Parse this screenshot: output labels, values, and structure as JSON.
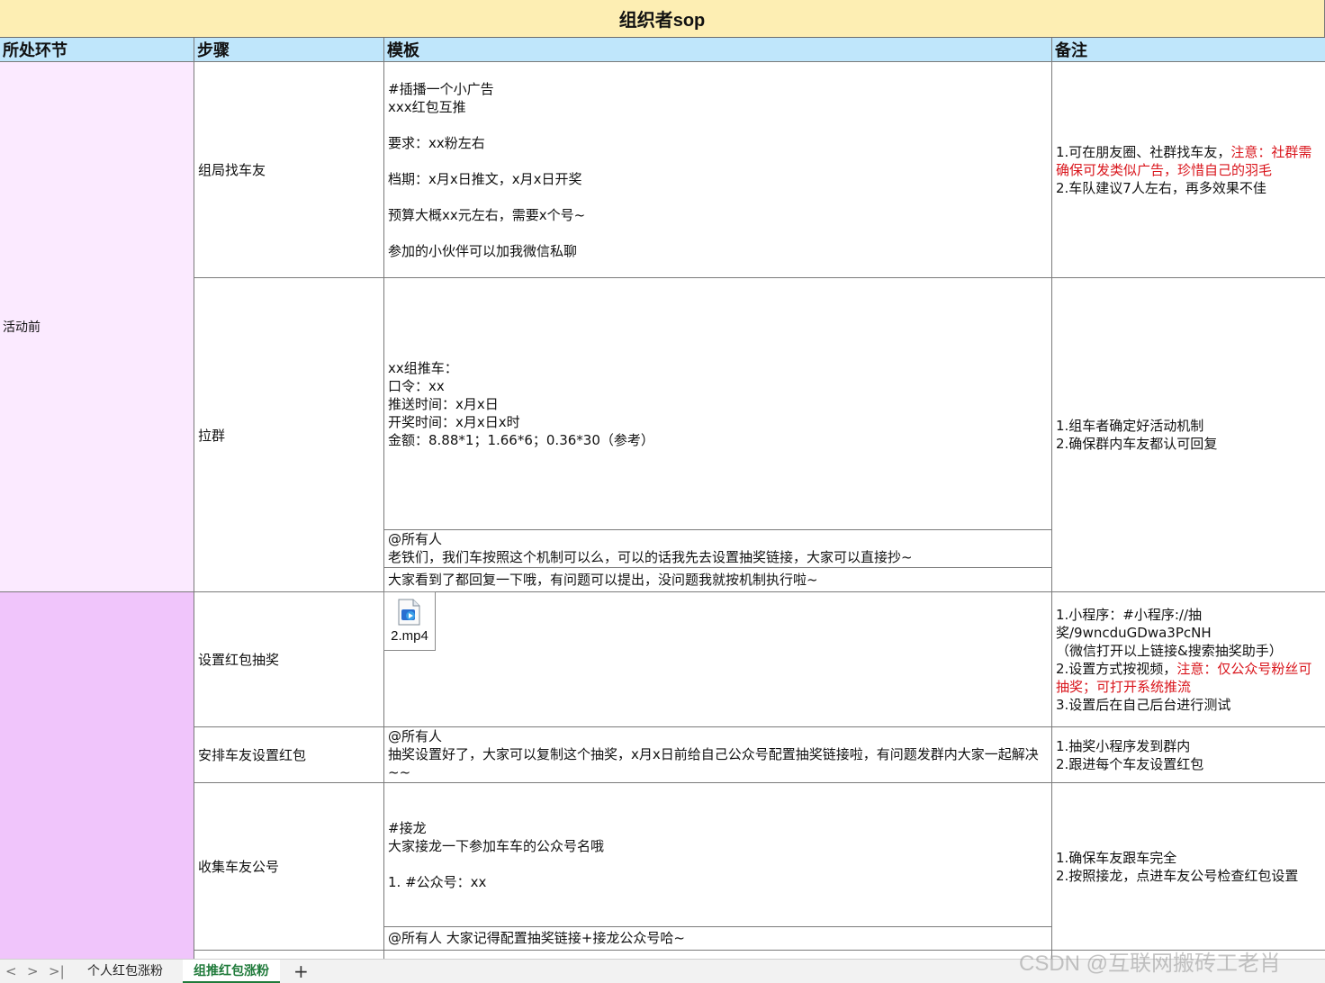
{
  "title": "组织者sop",
  "headers": {
    "stage": "所处环节",
    "step": "步骤",
    "template": "模板",
    "note": "备注"
  },
  "stages": {
    "before": "活动前",
    "during": ""
  },
  "rows": [
    {
      "step": "组局找车友",
      "template": "#插播一个小广告\nxxx红包互推\n\n要求：xx粉左右\n\n档期：x月x日推文，x月x日开奖\n\n预算大概xx元左右，需要x个号~\n\n参加的小伙伴可以加我微信私聊",
      "note_prefix": "1.可在朋友圈、社群找车友，",
      "note_red": "注意：社群需确保可发类似广告，珍惜自己的羽毛",
      "note_suffix": "\n2.车队建议7人左右，再多效果不佳"
    },
    {
      "step": "拉群",
      "template": "xx组推车：\n口令：xx\n推送时间：x月x日\n开奖时间：x月x日x时\n金额：8.88*1；1.66*6；0.36*30（参考）",
      "template_2": "@所有人\n老铁们，我们车按照这个机制可以么，可以的话我先去设置抽奖链接，大家可以直接抄~",
      "template_3": "大家看到了都回复一下哦，有问题可以提出，没问题我就按机制执行啦~",
      "note": "1.组车者确定好活动机制\n2.确保群内车友都认可回复"
    },
    {
      "step": "设置红包抽奖",
      "attachment": "2.mp4",
      "note_prefix": "1.小程序：#小程序://抽奖/9wncduGDwa3PcNH\n（微信打开以上链接&搜索抽奖助手）\n2.设置方式按视频，",
      "note_red": "注意：仅公众号粉丝可抽奖；可打开系统推流",
      "note_suffix": "\n3.设置后在自己后台进行测试"
    },
    {
      "step": "安排车友设置红包",
      "template": "@所有人\n抽奖设置好了，大家可以复制这个抽奖，x月x日前给自己公众号配置抽奖链接啦，有问题发群内大家一起解决~~",
      "note": "1.抽奖小程序发到群内\n2.跟进每个车友设置红包"
    },
    {
      "step": "收集车友公号",
      "template": "#接龙\n大家接龙一下参加车车的公众号名哦\n\n1. #公众号：xx",
      "template_2": "@所有人 大家记得配置抽奖链接+接龙公众号哈~",
      "note": "1.确保车友跟车完全\n2.按照接龙，点进车友公号检查红包设置"
    }
  ],
  "sheet_tabs": {
    "tab1": "个人红包涨粉",
    "tab2": "组推红包涨粉",
    "add": "+"
  },
  "nav": {
    "first": "<",
    "next": ">",
    "last": ">|"
  },
  "watermark": "CSDN @互联网搬砖工老肖",
  "colors": {
    "title_bg": "#fdeeb3",
    "header_bg": "#bfe6fb",
    "stage1_bg": "#fbeaff",
    "stage2_bg": "#f0c5fb",
    "red_text": "#d9141b"
  }
}
